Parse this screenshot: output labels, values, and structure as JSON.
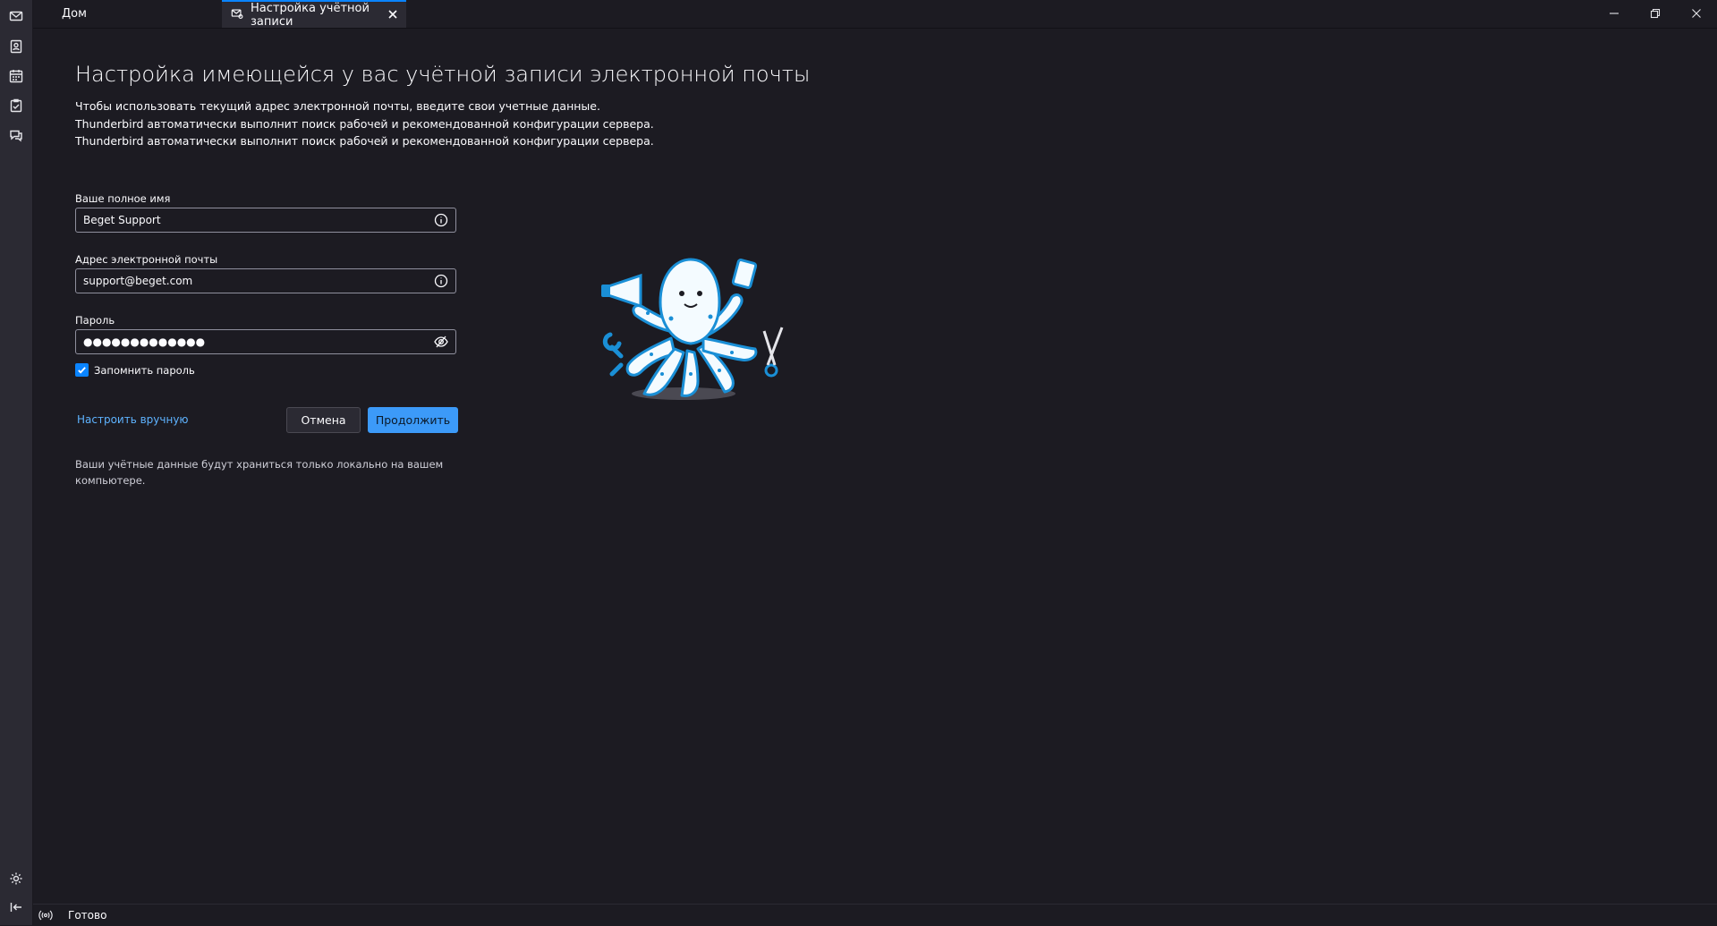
{
  "tabs": {
    "home_label": "Дом",
    "account_label": "Настройка учётной записи"
  },
  "page": {
    "title": "Настройка имеющейся у вас учётной записи электронной почты",
    "desc_line1": "Чтобы использовать текущий адрес электронной почты, введите свои учетные данные.",
    "desc_line2": "Thunderbird автоматически выполнит поиск рабочей и рекомендованной конфигурации сервера.",
    "desc_line3": "Thunderbird автоматически выполнит поиск рабочей и рекомендованной конфигурации сервера."
  },
  "form": {
    "name_label": "Ваше полное имя",
    "name_value": "Beget Support",
    "email_label": "Адрес электронной почты",
    "email_value": "support@beget.com",
    "password_label": "Пароль",
    "password_value": "●●●●●●●●●●●●●",
    "remember_label": "Запомнить пароль",
    "remember_checked": true
  },
  "actions": {
    "manual_link": "Настроить вручную",
    "cancel": "Отмена",
    "continue": "Продолжить"
  },
  "note": {
    "line1": "Ваши учётные данные будут храниться только локально на вашем",
    "line2": "компьютере."
  },
  "status": {
    "text": "Готово"
  },
  "colors": {
    "accent": "#0a84ff",
    "primary_button": "#3c9af8",
    "link": "#5eb3ff",
    "background": "#1c1b22"
  },
  "icons": {
    "sidebar": [
      "mail-icon",
      "address-book-icon",
      "calendar-icon",
      "tasks-icon",
      "chat-icon",
      "settings-icon",
      "collapse-icon"
    ],
    "field_info": "info-icon",
    "password_toggle": "eye-slash-icon",
    "status": "broadcast-icon"
  }
}
